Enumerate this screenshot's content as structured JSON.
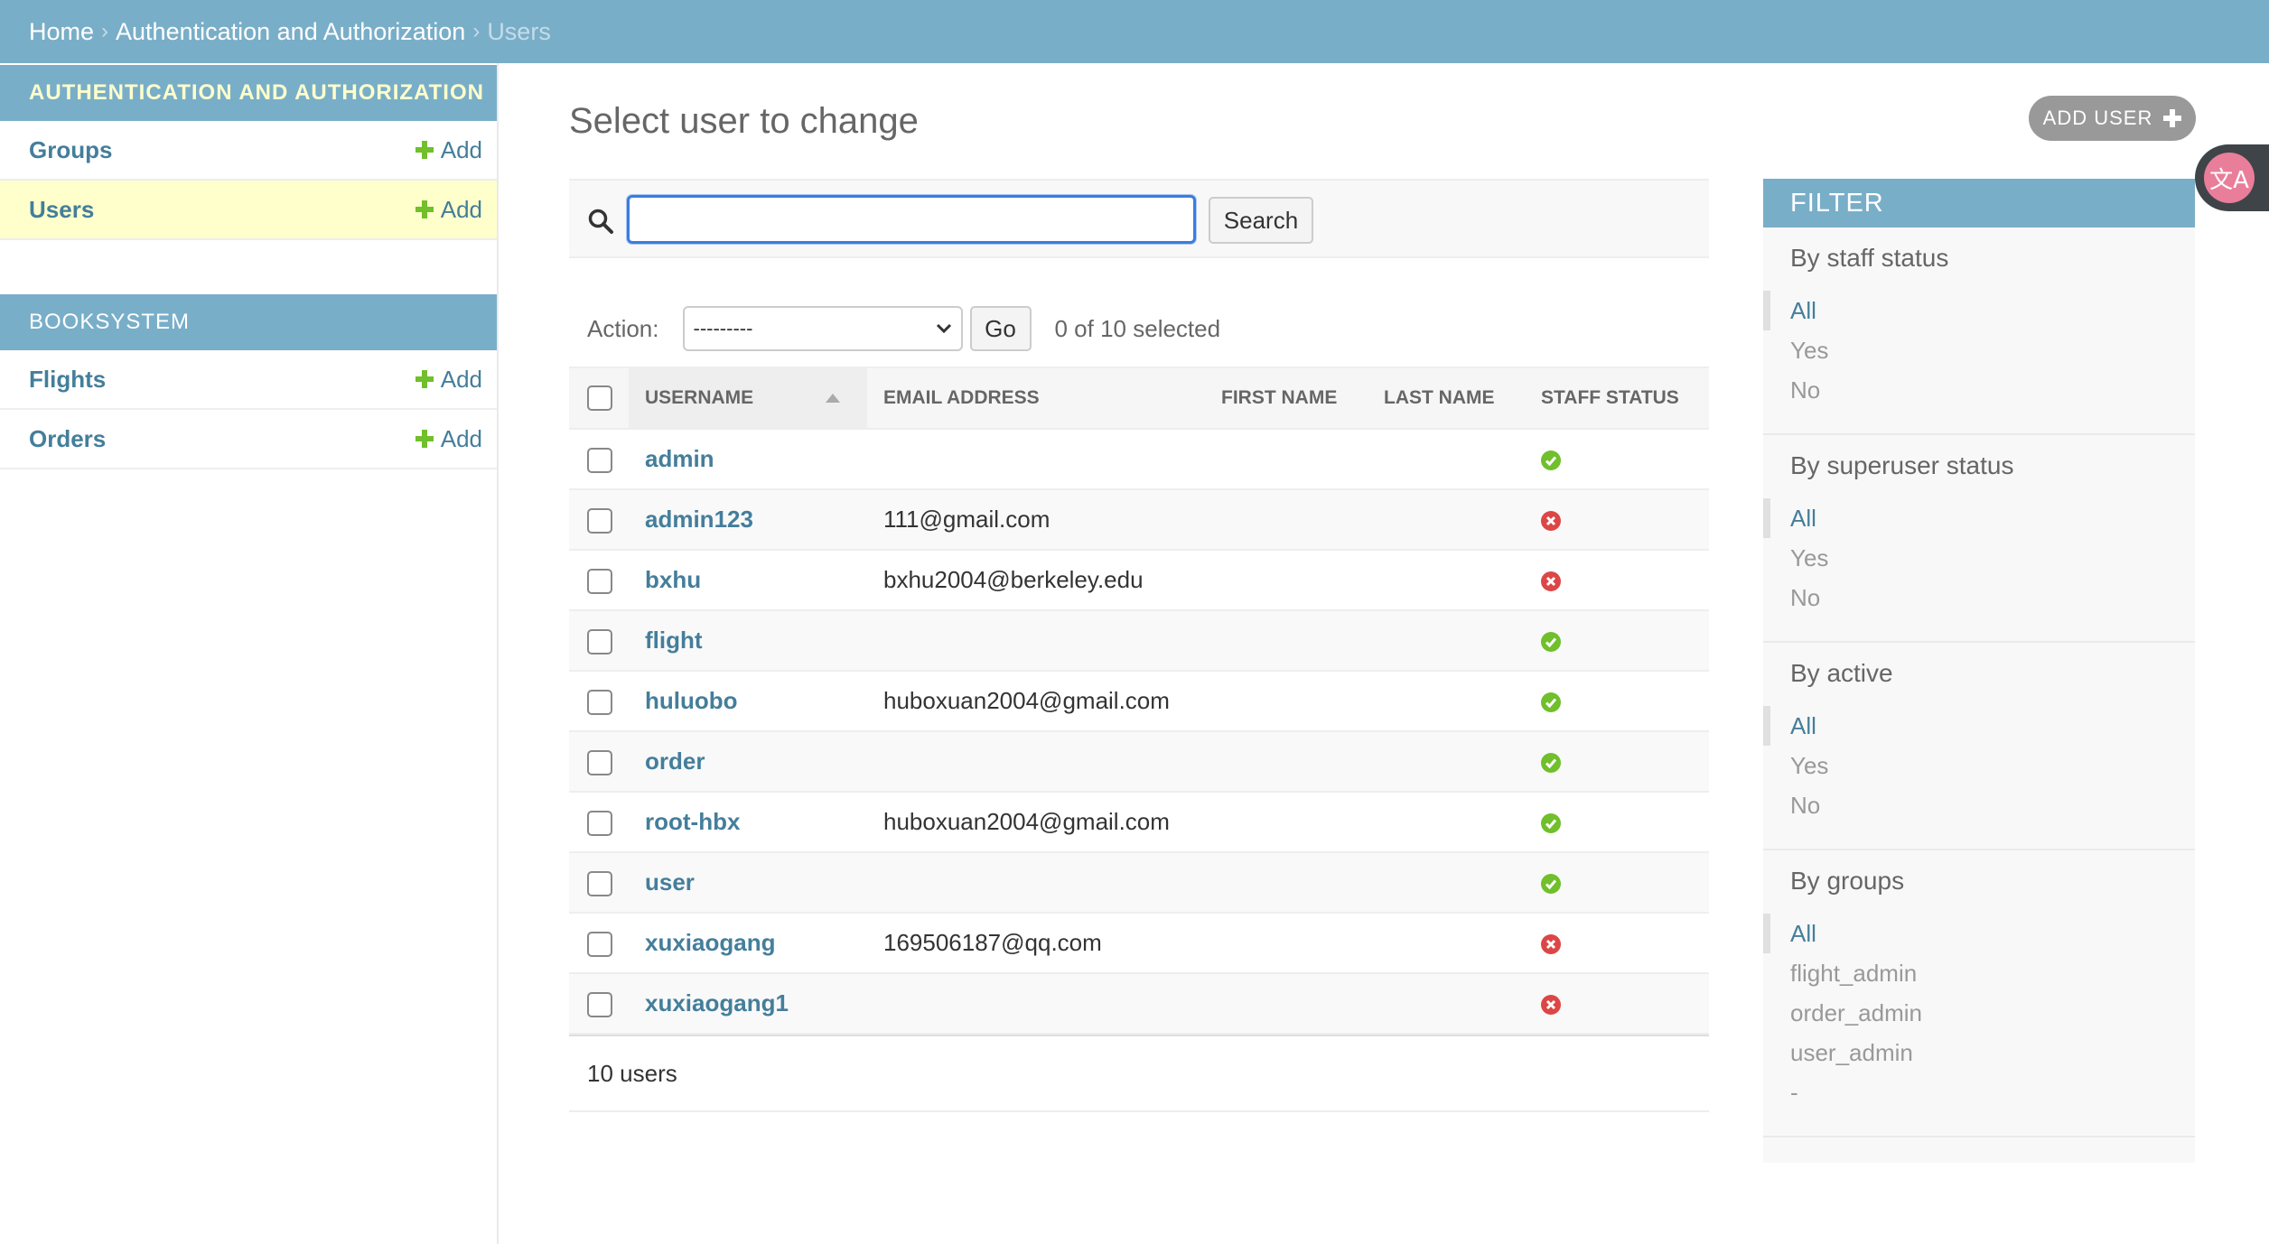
{
  "breadcrumbs": {
    "home": "Home",
    "section": "Authentication and Authorization",
    "current": "Users",
    "separator": "›"
  },
  "sidebar": {
    "modules": [
      {
        "title": "Authentication and Authorization",
        "models": [
          {
            "name": "Groups",
            "add": "Add"
          },
          {
            "name": "Users",
            "add": "Add"
          }
        ]
      },
      {
        "title": "Booksystem",
        "models": [
          {
            "name": "Flights",
            "add": "Add"
          },
          {
            "name": "Orders",
            "add": "Add"
          }
        ]
      }
    ]
  },
  "main": {
    "title": "Select user to change",
    "add_button": "ADD USER",
    "search": {
      "value": "",
      "button": "Search"
    },
    "actions": {
      "label": "Action:",
      "selected_option": "---------",
      "go": "Go",
      "selected_count": "0 of 10 selected"
    },
    "table": {
      "headers": [
        "Username",
        "Email address",
        "First name",
        "Last name",
        "Staff status"
      ],
      "rows": [
        {
          "username": "admin",
          "email": "",
          "first_name": "",
          "last_name": "",
          "staff": true
        },
        {
          "username": "admin123",
          "email": "111@gmail.com",
          "first_name": "",
          "last_name": "",
          "staff": false
        },
        {
          "username": "bxhu",
          "email": "bxhu2004@berkeley.edu",
          "first_name": "",
          "last_name": "",
          "staff": false
        },
        {
          "username": "flight",
          "email": "",
          "first_name": "",
          "last_name": "",
          "staff": true
        },
        {
          "username": "huluobo",
          "email": "huboxuan2004@gmail.com",
          "first_name": "",
          "last_name": "",
          "staff": true
        },
        {
          "username": "order",
          "email": "",
          "first_name": "",
          "last_name": "",
          "staff": true
        },
        {
          "username": "root-hbx",
          "email": "huboxuan2004@gmail.com",
          "first_name": "",
          "last_name": "",
          "staff": true
        },
        {
          "username": "user",
          "email": "",
          "first_name": "",
          "last_name": "",
          "staff": true
        },
        {
          "username": "xuxiaogang",
          "email": "169506187@qq.com",
          "first_name": "",
          "last_name": "",
          "staff": false
        },
        {
          "username": "xuxiaogang1",
          "email": "",
          "first_name": "",
          "last_name": "",
          "staff": false
        }
      ]
    },
    "paginator": "10 users"
  },
  "filter": {
    "title": "FILTER",
    "sections": [
      {
        "title": "By staff status",
        "options": [
          "All",
          "Yes",
          "No"
        ]
      },
      {
        "title": "By superuser status",
        "options": [
          "All",
          "Yes",
          "No"
        ]
      },
      {
        "title": "By active",
        "options": [
          "All",
          "Yes",
          "No"
        ]
      },
      {
        "title": "By groups",
        "options": [
          "All",
          "flight_admin",
          "order_admin",
          "user_admin",
          "-"
        ]
      }
    ]
  },
  "translate_badge": {
    "icon": "translate-icon",
    "glyph": "文A"
  },
  "colors": {
    "header_bar": "#79aec8",
    "link": "#447e9b",
    "selected_row": "#ffffcc",
    "add_green": "#70bf2b",
    "status_no": "#dd4646",
    "focus_blue": "#3b7ddd"
  }
}
